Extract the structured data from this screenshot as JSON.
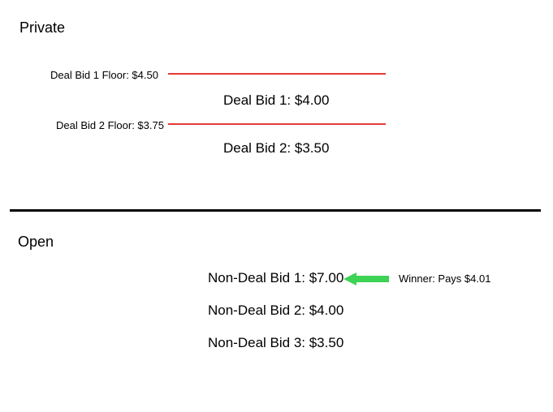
{
  "private": {
    "label": "Private",
    "floors": [
      {
        "label": "Deal Bid 1 Floor: $4.50"
      },
      {
        "label": "Deal Bid 2 Floor: $3.75"
      }
    ],
    "bids": [
      {
        "label": "Deal Bid 1: $4.00"
      },
      {
        "label": "Deal Bid 2: $3.50"
      }
    ]
  },
  "open": {
    "label": "Open",
    "bids": [
      {
        "label": "Non-Deal Bid 1: $7.00"
      },
      {
        "label": "Non-Deal Bid 2: $4.00"
      },
      {
        "label": "Non-Deal Bid 3: $3.50"
      }
    ],
    "winner_annotation": "Winner: Pays $4.01"
  },
  "colors": {
    "floor_line": "#e53935",
    "arrow": "#3dd354"
  }
}
